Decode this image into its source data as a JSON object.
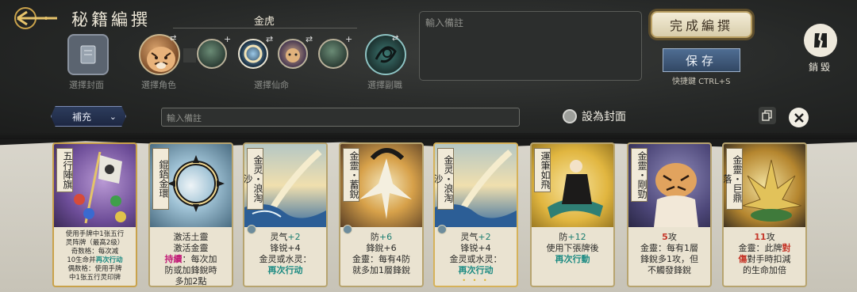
{
  "header": {
    "title": "秘籍編撰",
    "section_name": "金虎"
  },
  "slots": {
    "cover_label": "選擇封面",
    "character_label": "選擇角色",
    "immortal_label": "選擇仙命",
    "sub_label": "選擇副職"
  },
  "note_top": {
    "placeholder": "輸入備註"
  },
  "actions": {
    "finish": "完成編撰",
    "save": "保存",
    "shortcut": "快捷鍵 CTRL+S",
    "destroy": "銷毀"
  },
  "filter": {
    "label": "補充"
  },
  "note_bar": {
    "placeholder": "輸入備註"
  },
  "cover_toggle": {
    "label": "設為封面"
  },
  "cards": [
    {
      "name": "五行陣旗",
      "lines": [
        "使用手牌中1张五行",
        "灵阵牌（最高2级）",
        "奇数格：每次减",
        "10生命并",
        "再次行动",
        "偶数格：使用手牌",
        "中1张五行灵印牌"
      ]
    },
    {
      "name": "錕鋙金環",
      "lines": [
        "激活土靈",
        "激活金靈",
        "持續",
        "：每次加",
        "防或加鋒銳時",
        "多加2點"
      ]
    },
    {
      "name": "金灵・浪淘沙",
      "lines": [
        "灵气",
        "+2",
        "锋锐+4",
        "金灵或水灵：",
        "再次行动"
      ]
    },
    {
      "name": "金靈・蓄銳",
      "lines": [
        "防",
        "+6",
        "鋒銳+6",
        "金靈：每有4防",
        "就多加1層鋒銳"
      ]
    },
    {
      "name": "金灵・浪淘沙",
      "lines": [
        "灵气",
        "+2",
        "锋锐+4",
        "金灵或水灵：",
        "再次行动"
      ]
    },
    {
      "name": "運筆如飛",
      "lines": [
        "防",
        "+12",
        "使用下張牌後",
        "再次行動"
      ]
    },
    {
      "name": "金靈・剛勁",
      "lines": [
        "5",
        "攻",
        "金靈：每有1層",
        "鋒銳多1攻，但",
        "不觸發鋒銳"
      ]
    },
    {
      "name": "金靈・巨鼎落",
      "lines": [
        "11",
        "攻",
        "金靈：此牌",
        "對",
        "傷",
        "對手時扣減",
        "的生命加倍"
      ]
    }
  ]
}
